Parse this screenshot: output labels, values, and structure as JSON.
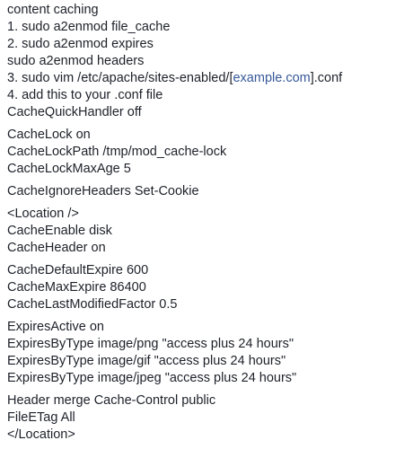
{
  "paragraphs": [
    {
      "lines": [
        "content caching",
        "1. sudo a2enmod file_cache",
        "2. sudo a2enmod expires",
        "sudo a2enmod headers",
        {
          "before": "3. sudo vim /etc/apache/sites-enabled/[",
          "link": "example.com",
          "after": "].conf"
        },
        "4. add this to your .conf file",
        "CacheQuickHandler off"
      ]
    },
    {
      "lines": [
        "CacheLock on",
        "CacheLockPath /tmp/mod_cache-lock",
        "CacheLockMaxAge 5"
      ]
    },
    {
      "lines": [
        "CacheIgnoreHeaders Set-Cookie"
      ]
    },
    {
      "lines": [
        "<Location />",
        "CacheEnable disk",
        "CacheHeader on"
      ]
    },
    {
      "lines": [
        "CacheDefaultExpire 600",
        "CacheMaxExpire 86400",
        "CacheLastModifiedFactor 0.5"
      ]
    },
    {
      "lines": [
        "ExpiresActive on",
        "ExpiresByType image/png \"access plus 24 hours\"",
        "ExpiresByType image/gif \"access plus 24 hours\"",
        "ExpiresByType image/jpeg \"access plus 24 hours\""
      ]
    },
    {
      "lines": [
        "Header merge Cache-Control public",
        "FileETag All",
        "</Location>"
      ]
    }
  ],
  "colors": {
    "text": "#1d2129",
    "link": "#365899",
    "background": "#ffffff"
  }
}
